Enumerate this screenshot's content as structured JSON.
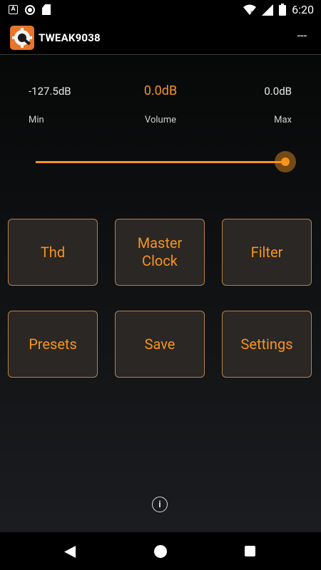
{
  "status_bar": {
    "time": "6:20"
  },
  "app_bar": {
    "title": "TWEAK9038",
    "overflow_label": "---"
  },
  "volume": {
    "min_value": "-127.5dB",
    "current_value": "0.0dB",
    "max_value": "0.0dB",
    "min_label": "Min",
    "volume_label": "Volume",
    "max_label": "Max",
    "slider_position_fraction": 1.0
  },
  "buttons": {
    "thd": "Thd",
    "master_clock": "Master\nClock",
    "filter": "Filter",
    "presets": "Presets",
    "save": "Save",
    "settings": "Settings"
  },
  "colors": {
    "accent": "#f7941d",
    "button_border": "#b8824a",
    "button_bg": "#2a2724"
  },
  "icons": [
    "notification-a-icon",
    "record-icon",
    "sd-card-icon",
    "wifi-icon",
    "signal-icon",
    "battery-icon",
    "app-gear-wrench-icon",
    "info-icon",
    "back-icon",
    "home-icon",
    "recents-icon"
  ]
}
